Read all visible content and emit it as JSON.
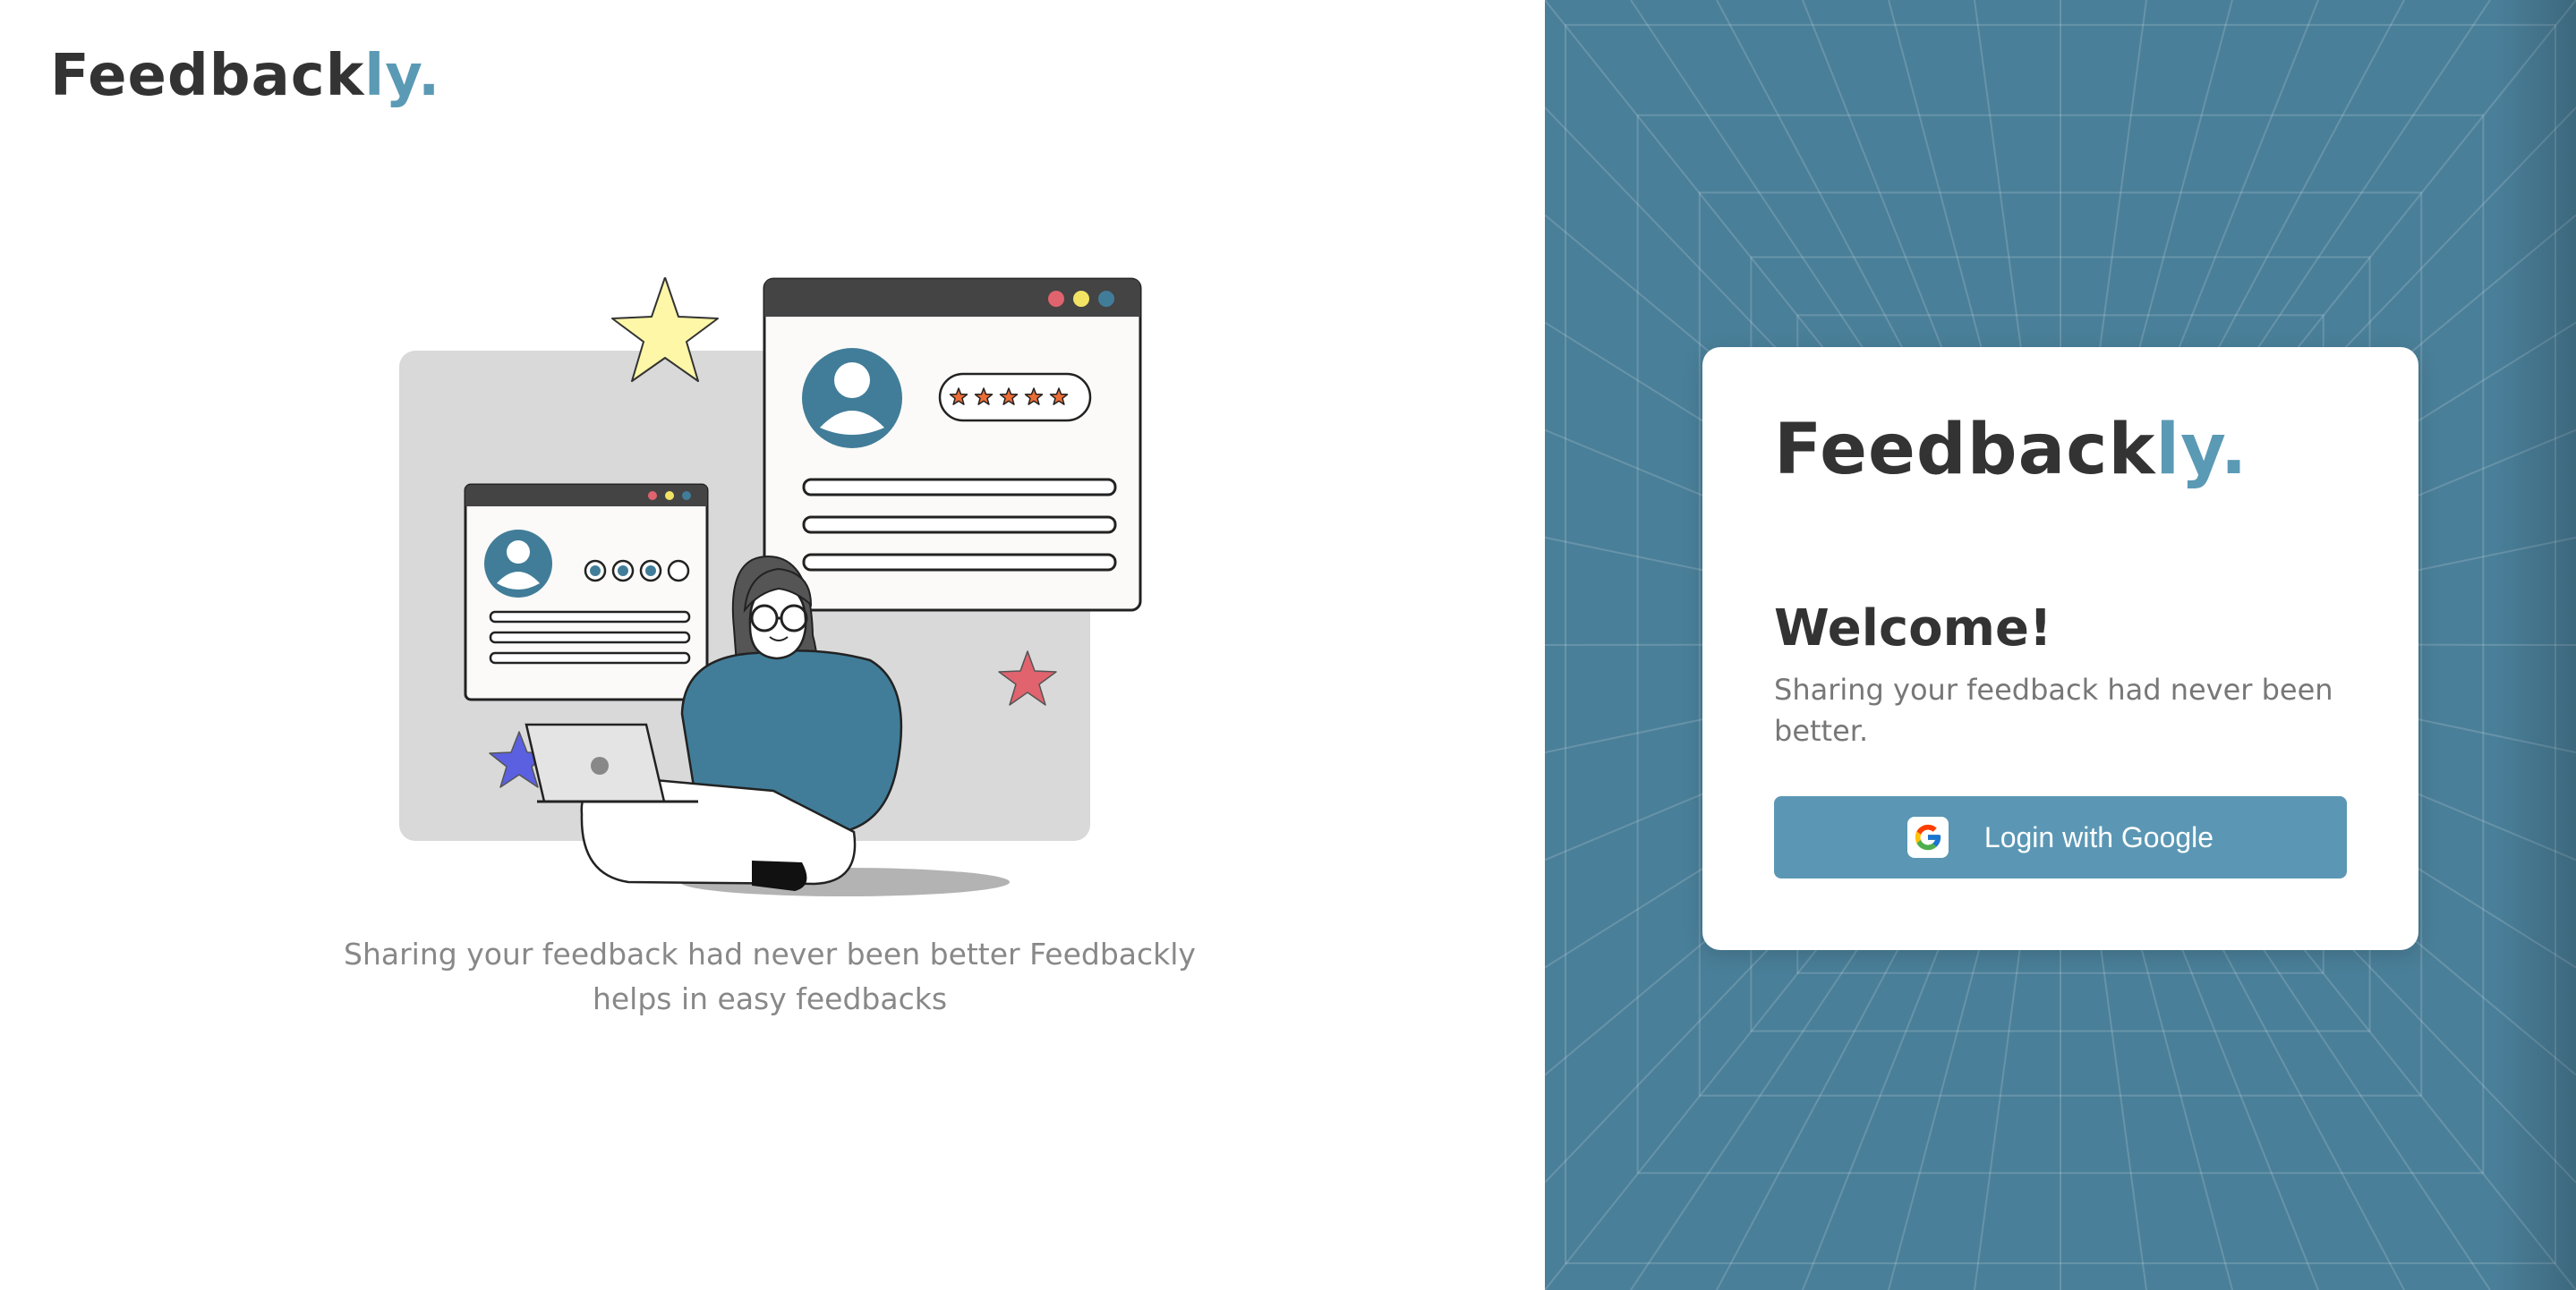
{
  "theme": {
    "accent": "#5b9ab5",
    "button": "#5b97b4",
    "panel": "#4a7f99",
    "illustration_blue": "#417d99",
    "star_yellow": "#fdf7a7",
    "star_red": "#e0636e",
    "star_purple": "#5b60e0",
    "star_orange": "#ec6d36"
  },
  "brand": {
    "prefix": "Feedback",
    "suffix": "ly."
  },
  "hero": {
    "tagline": "Sharing your feedback had never been better Feedbackly helps in easy feedbacks",
    "rating_stars": 5,
    "rating_dots_filled": 3,
    "rating_dots_total": 4
  },
  "login_card": {
    "brand_prefix": "Feedback",
    "brand_suffix": "ly.",
    "heading": "Welcome!",
    "subtitle": "Sharing your feedback had never been better.",
    "google_button_label": "Login with Google",
    "google_icon": "google-g-logo"
  }
}
